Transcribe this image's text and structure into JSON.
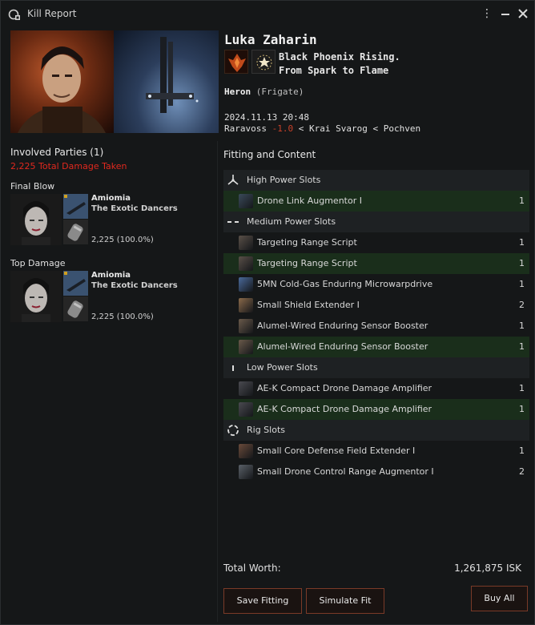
{
  "window": {
    "title": "Kill Report",
    "colors": {
      "background": "#151718",
      "accent_red": "#e0281e",
      "highlight_row": "#1a2e1b",
      "button_border": "#7a3a28"
    }
  },
  "victim": {
    "name": "Luka Zaharin",
    "corp_line1": "Black Phoenix Rising.",
    "corp_line2": "From Spark to Flame",
    "ship_name": "Heron",
    "ship_class": "(Frigate)",
    "datetime": "2024.11.13 20:48",
    "system": "Raravoss",
    "security": "-1.0",
    "sep1": "<",
    "constellation": "Krai Svarog",
    "sep2": "<",
    "region": "Pochven"
  },
  "involved": {
    "header": "Involved Parties (1)",
    "damage_taken": "2,225 Total Damage Taken",
    "final_blow_label": "Final Blow",
    "top_damage_label": "Top Damage",
    "final_blow": {
      "name": "Amiomia",
      "corp": "The Exotic Dancers",
      "damage": "2,225 (100.0%)"
    },
    "top_damage": {
      "name": "Amiomia",
      "corp": "The Exotic Dancers",
      "damage": "2,225 (100.0%)"
    }
  },
  "fitting": {
    "header": "Fitting and Content",
    "high_slots_label": "High Power Slots",
    "medium_slots_label": "Medium Power Slots",
    "low_slots_label": "Low Power Slots",
    "rig_slots_label": "Rig Slots",
    "high": [
      {
        "name": "Drone Link Augmentor I",
        "qty": "1",
        "icon": "drone-link-icon",
        "color": "#3a4a5a"
      }
    ],
    "medium": [
      {
        "name": "Targeting Range Script",
        "qty": "1",
        "icon": "script-icon",
        "color": "#5a5048"
      },
      {
        "name": "Targeting Range Script",
        "qty": "1",
        "icon": "script-icon",
        "color": "#5a5048"
      },
      {
        "name": "5MN Cold-Gas Enduring Microwarpdrive",
        "qty": "1",
        "icon": "microwarpdrive-icon",
        "color": "#4a6a9a"
      },
      {
        "name": "Small Shield Extender I",
        "qty": "2",
        "icon": "shield-extender-icon",
        "color": "#8a6a4a"
      },
      {
        "name": "Alumel-Wired Enduring Sensor Booster",
        "qty": "1",
        "icon": "sensor-booster-icon",
        "color": "#6a5a4a"
      },
      {
        "name": "Alumel-Wired Enduring Sensor Booster",
        "qty": "1",
        "icon": "sensor-booster-icon",
        "color": "#6a5a4a"
      }
    ],
    "low": [
      {
        "name": "AE-K Compact Drone Damage Amplifier",
        "qty": "1",
        "icon": "drone-damage-amplifier-icon",
        "color": "#4a4a50"
      },
      {
        "name": "AE-K Compact Drone Damage Amplifier",
        "qty": "1",
        "icon": "drone-damage-amplifier-icon",
        "color": "#4a4a50"
      }
    ],
    "rig": [
      {
        "name": "Small Core Defense Field Extender I",
        "qty": "1",
        "icon": "rig-shield-icon",
        "color": "#6a4a3a"
      },
      {
        "name": "Small Drone Control Range Augmentor I",
        "qty": "2",
        "icon": "rig-drone-icon",
        "color": "#5a6068"
      }
    ]
  },
  "totals": {
    "label": "Total Worth:",
    "value": "1,261,875 ISK"
  },
  "buttons": {
    "save_fitting": "Save Fitting",
    "simulate_fit": "Simulate Fit",
    "buy_all": "Buy All"
  }
}
